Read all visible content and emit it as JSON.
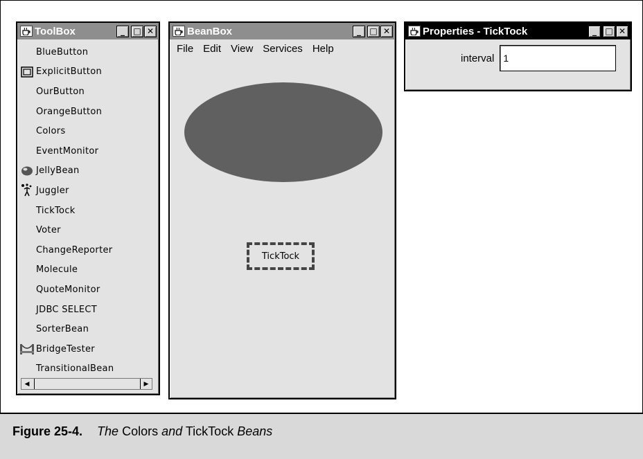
{
  "toolbox": {
    "title": "ToolBox",
    "items": [
      {
        "label": "BlueButton",
        "icon": ""
      },
      {
        "label": "ExplicitButton",
        "icon": "explicit-button-icon"
      },
      {
        "label": "OurButton",
        "icon": ""
      },
      {
        "label": "OrangeButton",
        "icon": ""
      },
      {
        "label": "Colors",
        "icon": ""
      },
      {
        "label": "EventMonitor",
        "icon": ""
      },
      {
        "label": "JellyBean",
        "icon": "jellybean-icon"
      },
      {
        "label": "Juggler",
        "icon": "juggler-icon"
      },
      {
        "label": "TickTock",
        "icon": ""
      },
      {
        "label": "Voter",
        "icon": ""
      },
      {
        "label": "ChangeReporter",
        "icon": ""
      },
      {
        "label": "Molecule",
        "icon": ""
      },
      {
        "label": "QuoteMonitor",
        "icon": ""
      },
      {
        "label": "JDBC SELECT",
        "icon": ""
      },
      {
        "label": "SorterBean",
        "icon": ""
      },
      {
        "label": "BridgeTester",
        "icon": "bridge-icon"
      },
      {
        "label": "TransitionalBean",
        "icon": ""
      }
    ]
  },
  "beanbox": {
    "title": "BeanBox",
    "menu": [
      "File",
      "Edit",
      "View",
      "Services",
      "Help"
    ],
    "bean_label": "TickTock",
    "oval_color": "#606060"
  },
  "properties": {
    "title": "Properties - TickTock",
    "field_label": "interval",
    "field_value": "1"
  },
  "window_controls": {
    "minimize": "_",
    "maximize": "□",
    "close": "✕"
  },
  "caption": {
    "figure": "Figure 25-4.",
    "part1": "The",
    "part2": "Colors",
    "part3": "and",
    "part4": "TickTock",
    "part5": "Beans"
  }
}
